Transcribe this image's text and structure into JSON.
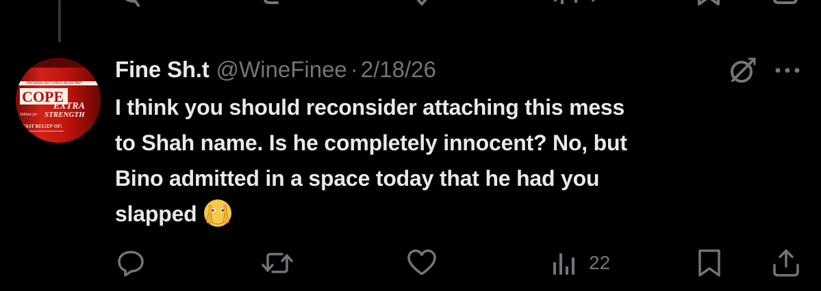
{
  "tweet": {
    "display_name": "Fine Sh.t",
    "handle": "@WineFinee",
    "separator": "·",
    "date": "2/18/26",
    "text_lines": [
      "I think you should reconsider attaching this mess",
      "to Shah name. Is he completely innocent? No, but",
      "Bino admitted in a space today that he had you",
      "slapped"
    ],
    "emoji": "face-with-open-eyes-and-hand-over-mouth"
  },
  "avatar": {
    "description_icon": "cope-extra-strength-bottle",
    "label_top": "COPE",
    "label_sub": "EXTRA",
    "label_sub2": "STRENGTH",
    "label_small": "Tablets for",
    "label_bottom": "FAST RELIEF OF:",
    "brand_color": "#b5120c"
  },
  "actions": {
    "reply": {
      "icon": "reply-icon",
      "count": ""
    },
    "repost": {
      "icon": "repost-icon",
      "count": ""
    },
    "like": {
      "icon": "heart-icon",
      "count": ""
    },
    "views": {
      "icon": "views-icon",
      "count": "22"
    },
    "bookmark": {
      "icon": "bookmark-icon",
      "count": ""
    },
    "share": {
      "icon": "share-icon",
      "count": ""
    }
  },
  "colors": {
    "background": "#000000",
    "text": "#e7e9ea",
    "muted": "#71767b",
    "thread_line": "#333639"
  }
}
